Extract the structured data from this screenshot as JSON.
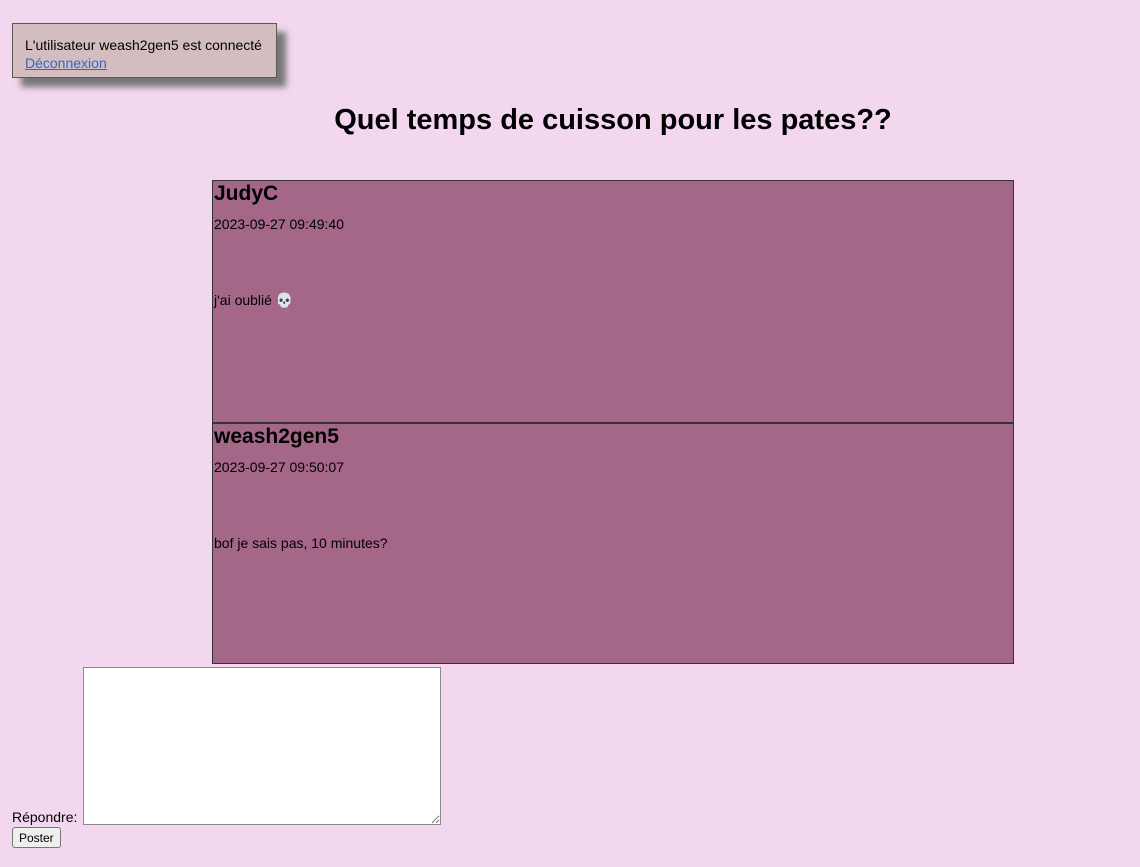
{
  "session": {
    "text": "L'utilisateur weash2gen5 est connecté",
    "logout_link": "Déconnexion"
  },
  "thread": {
    "title": "Quel temps de cuisson pour les pates??"
  },
  "messages": [
    {
      "author": "JudyC",
      "date": "2023-09-27 09:49:40",
      "text": "j'ai oublié 💀"
    },
    {
      "author": "weash2gen5",
      "date": "2023-09-27 09:50:07",
      "text": "bof je sais pas, 10 minutes?"
    }
  ],
  "reply": {
    "label": "Répondre:",
    "value": "",
    "button": "Poster"
  },
  "colors": {
    "page_background": "#f2d7ee",
    "message_background": "#a46787",
    "session_box_background": "#d4bdc1",
    "link": "#2a6bc9"
  }
}
